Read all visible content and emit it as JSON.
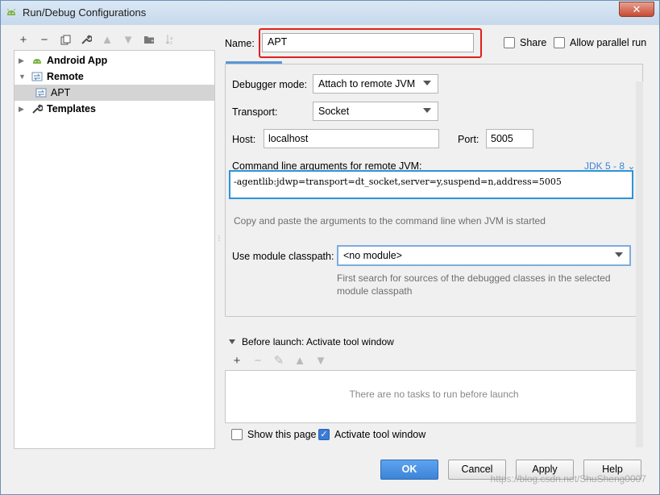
{
  "window": {
    "title": "Run/Debug Configurations",
    "close_glyph": "✕"
  },
  "toolbar": {
    "add": "+",
    "remove": "−",
    "copy": "⧉",
    "edit": "🔧",
    "up": "▲",
    "down": "▼",
    "folder": "📁",
    "sort": "↓ᵃ"
  },
  "tree": {
    "items": [
      {
        "label": "Android App",
        "icon": "android-icon"
      },
      {
        "label": "Remote",
        "icon": "remote-icon"
      },
      {
        "label": "APT",
        "icon": "remote-config-icon"
      },
      {
        "label": "Templates",
        "icon": "wrench-icon"
      }
    ]
  },
  "config": {
    "name_label": "Name:",
    "name_value": "APT",
    "share_label": "Share",
    "parallel_label": "Allow parallel run",
    "debugger_mode_label": "Debugger mode:",
    "debugger_mode_value": "Attach to remote JVM",
    "transport_label": "Transport:",
    "transport_value": "Socket",
    "host_label": "Host:",
    "host_value": "localhost",
    "port_label": "Port:",
    "port_value": "5005",
    "cmd_label": "Command line arguments for remote JVM:",
    "jdk_link": "JDK 5 - 8",
    "cmd_value": "-agentlib:jdwp=transport=dt_socket,server=y,suspend=n,address=5005",
    "cmd_hint": "Copy and paste the arguments to the command line when JVM is started",
    "module_label": "Use module classpath:",
    "module_value": "<no module>",
    "module_hint_1": "First search for sources of the debugged classes in the selected",
    "module_hint_2": "module classpath"
  },
  "before_launch": {
    "title": "Before launch: Activate tool window",
    "empty_text": "There are no tasks to run before launch"
  },
  "footer": {
    "show_page_label": "Show this page",
    "activate_label": "Activate tool window",
    "ok": "OK",
    "cancel": "Cancel",
    "apply": "Apply",
    "help": "Help",
    "watermark": "https://blog.csdn.net/ShuSheng0007"
  },
  "colors": {
    "accent": "#3d84d8",
    "highlight_red": "#e0201d",
    "focus_blue": "#2b94d8"
  }
}
